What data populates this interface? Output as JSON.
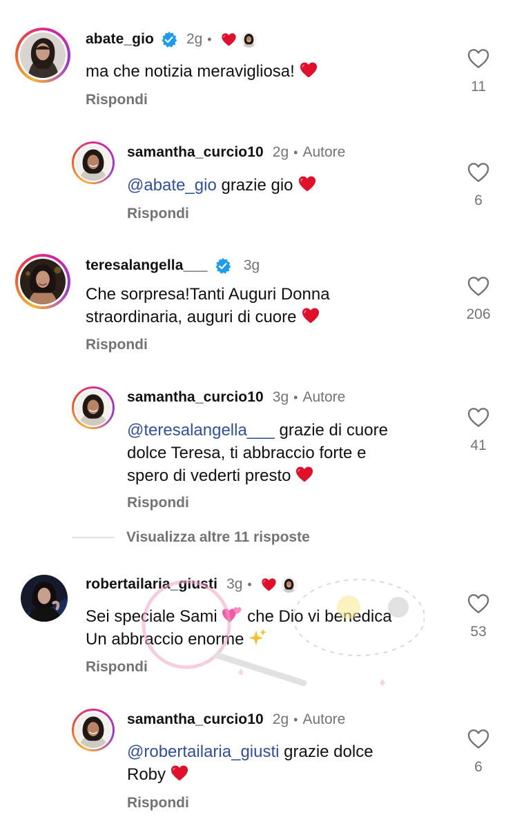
{
  "comments": [
    {
      "username": "abate_gio",
      "verified": true,
      "time": "2g",
      "separator": "•",
      "text": "ma che notizia meravigliosa!",
      "emoji": "heart-emoji",
      "reply_label": "Rispondi",
      "likes": "11"
    },
    {
      "username": "samantha_curcio10",
      "time": "2g",
      "separator": "•",
      "author_label": "Autore",
      "mention": "@abate_gio",
      "text": "grazie gio",
      "emoji": "heart-emoji",
      "reply_label": "Rispondi",
      "likes": "6"
    },
    {
      "username": "teresalangella___",
      "verified": true,
      "time": "3g",
      "text_line1": "Che sorpresa!Tanti Auguri Donna",
      "text_line2": "straordinaria, auguri di cuore",
      "emoji": "heart-emoji",
      "reply_label": "Rispondi",
      "likes": "206"
    },
    {
      "username": "samantha_curcio10",
      "time": "3g",
      "separator": "•",
      "author_label": "Autore",
      "mention": "@teresalangella___",
      "text_line1": "grazie di cuore",
      "text_line2": "dolce Teresa, ti abbraccio forte e",
      "text_line3": "spero di vederti presto",
      "emoji": "heart-emoji",
      "reply_label": "Rispondi",
      "likes": "41"
    },
    {
      "username": "robertailaria_giusti",
      "time": "3g",
      "separator": "•",
      "text_line1_a": "Sei speciale Sami",
      "text_line1_b": "che Dio vi benedica",
      "text_line2": "Un abbraccio enorme",
      "emoji1": "two-hearts-emoji",
      "emoji2": "sparkles-emoji",
      "reply_label": "Rispondi",
      "likes": "53"
    },
    {
      "username": "samantha_curcio10",
      "time": "2g",
      "separator": "•",
      "author_label": "Autore",
      "mention": "@robertailaria_giusti",
      "text_line1": "grazie dolce",
      "text_line2": "Roby",
      "emoji": "heart-emoji",
      "reply_label": "Rispondi",
      "likes": "6"
    }
  ],
  "view_more_label": "Visualizza altre 11 risposte",
  "colors": {
    "mention": "#2f4f9f",
    "secondary_text": "#737373",
    "heart": "#e0102a",
    "verified": "#1d9bf0"
  }
}
